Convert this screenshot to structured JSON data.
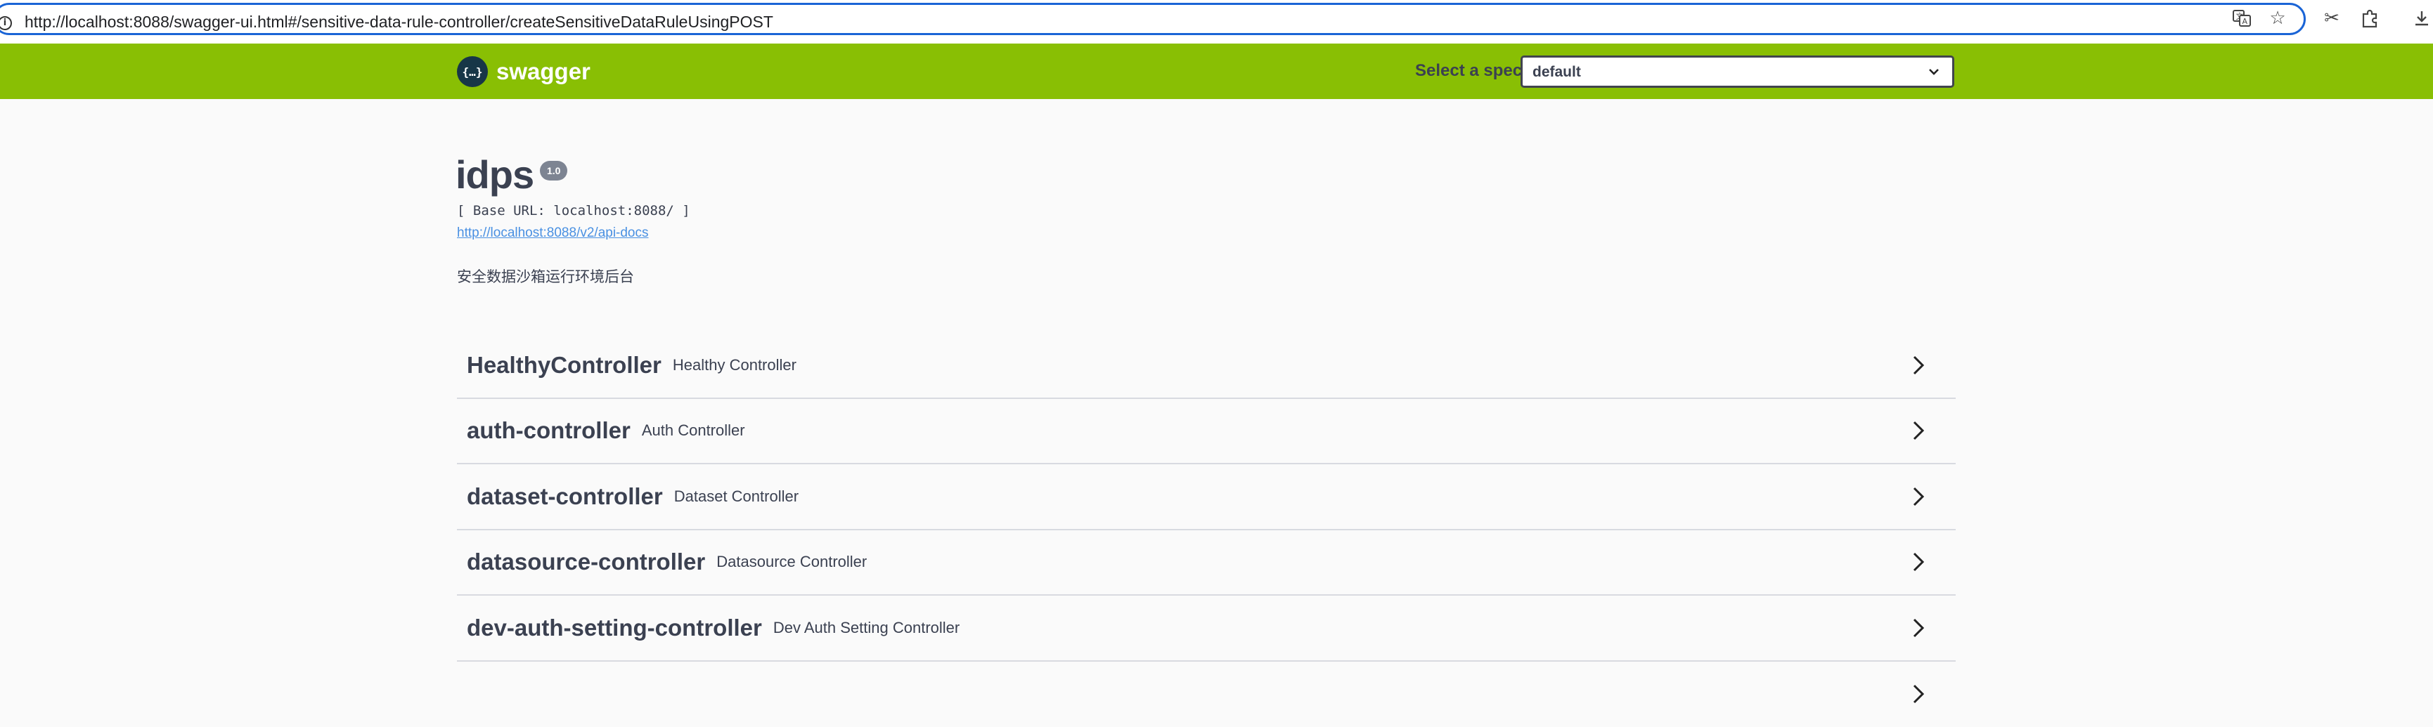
{
  "browser": {
    "url": "http://localhost:8088/swagger-ui.html#/sensitive-data-rule-controller/createSensitiveDataRuleUsingPOST",
    "icons": [
      "info-icon",
      "translate-icon",
      "bookmark-star-icon",
      "scissors-icon",
      "extensions-icon",
      "download-icon"
    ]
  },
  "topbar": {
    "logo_symbol": "{…}",
    "logo_text": "swagger",
    "spec_label": "Select a spec",
    "spec_selected": "default",
    "bg_color": "#89bf04"
  },
  "info": {
    "title": "idps",
    "version": "1.0",
    "base_url": "[ Base URL: localhost:8088/ ]",
    "api_docs_link": "http://localhost:8088/v2/api-docs",
    "description": "安全数据沙箱运行环境后台"
  },
  "controllers": [
    {
      "name": "HealthyController",
      "description": "Healthy Controller"
    },
    {
      "name": "auth-controller",
      "description": "Auth Controller"
    },
    {
      "name": "dataset-controller",
      "description": "Dataset Controller"
    },
    {
      "name": "datasource-controller",
      "description": "Datasource Controller"
    },
    {
      "name": "dev-auth-setting-controller",
      "description": "Dev Auth Setting Controller"
    }
  ]
}
